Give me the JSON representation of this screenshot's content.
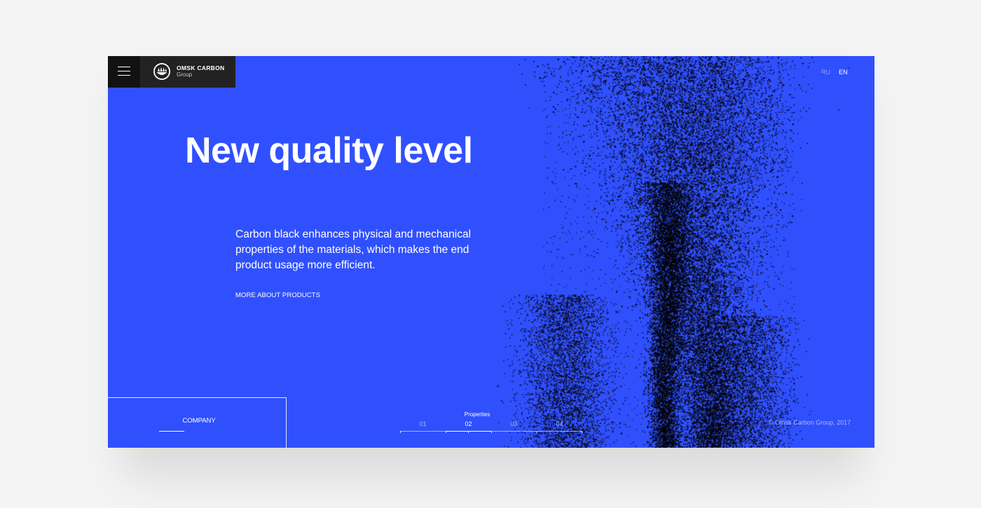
{
  "brand": {
    "name": "OMSK CARBON",
    "subtitle": "Group",
    "logo_icon": "omsk-carbon-logo-icon"
  },
  "header": {
    "menu_icon": "hamburger-menu-icon",
    "languages": [
      {
        "code": "RU",
        "active": false
      },
      {
        "code": "EN",
        "active": true
      }
    ]
  },
  "hero": {
    "title": "New quality level",
    "description": "Carbon black enhances physical and mechanical properties of the materials, which makes the end product usage more efficient.",
    "cta_label": "MORE ABOUT PRODUCTS"
  },
  "footer": {
    "company_label": "COMPANY",
    "pager_title": "Properties",
    "pages": [
      "01",
      "02",
      "03",
      "04"
    ],
    "active_page": "02",
    "copyright": "© Omsk Carbon Group, 2017"
  },
  "colors": {
    "background": "#3050fe",
    "page": "#f4f4f4",
    "menu_bg": "#121212",
    "logo_bg": "#222222",
    "text": "#ffffff",
    "particles": "#000000"
  }
}
